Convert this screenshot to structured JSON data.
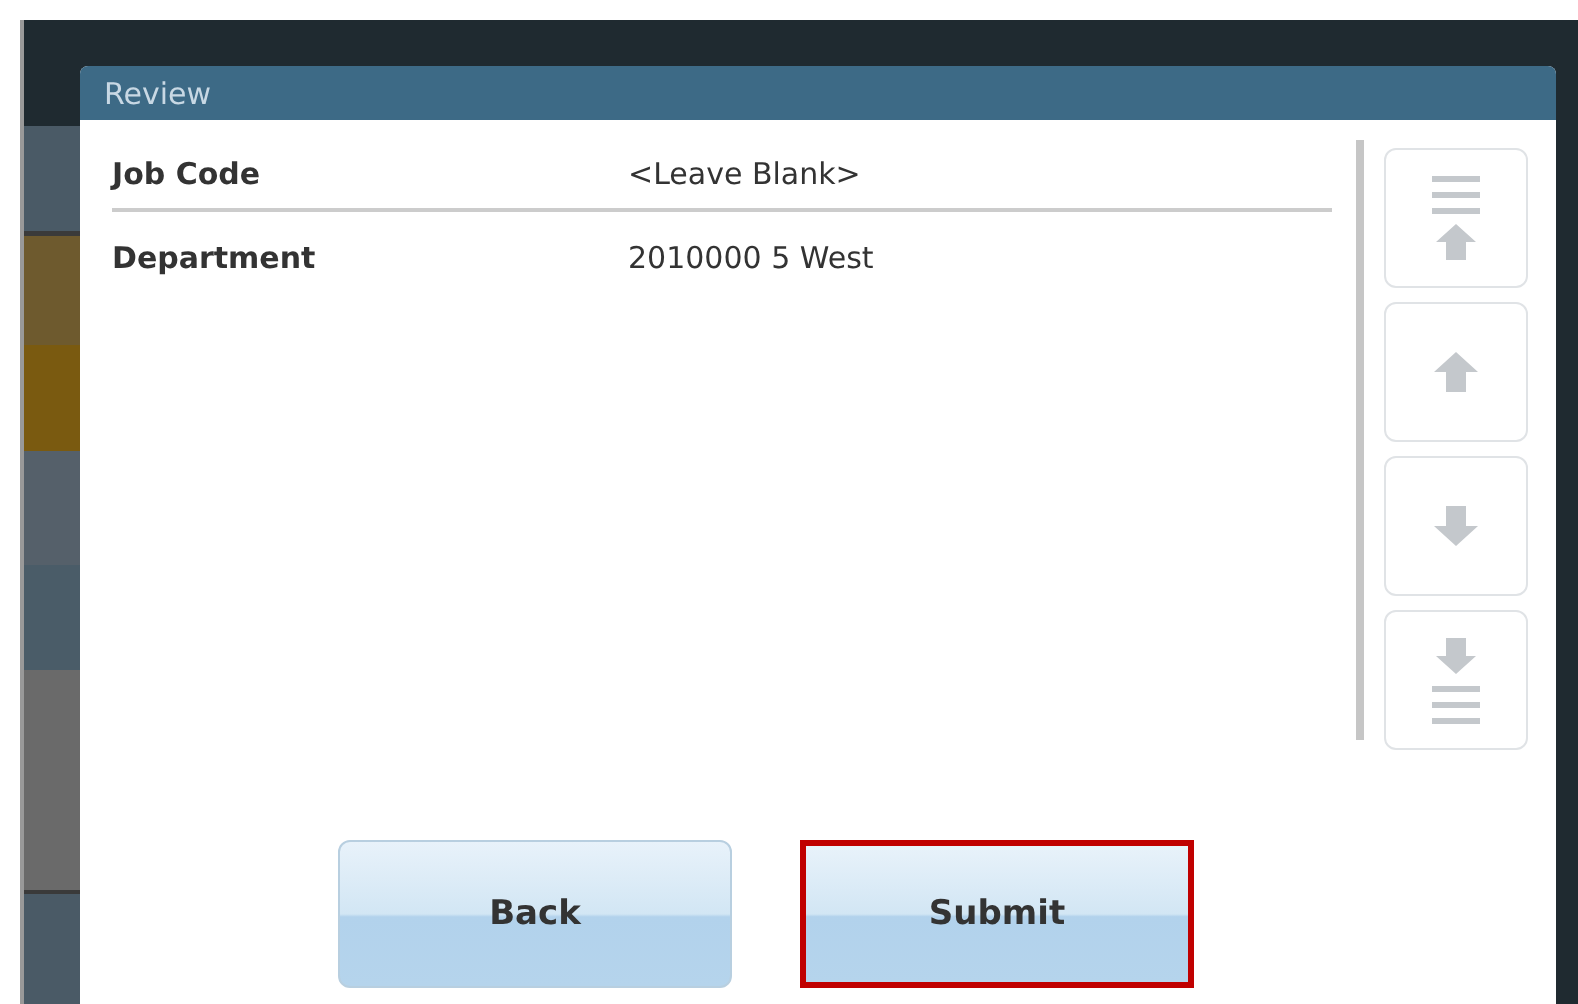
{
  "dialog": {
    "title": "Review",
    "fields": [
      {
        "label": "Job Code",
        "value": "<Leave Blank>"
      },
      {
        "label": "Department",
        "value": "2010000 5 West"
      }
    ],
    "scroll_buttons": [
      {
        "kind": "page-up"
      },
      {
        "kind": "up"
      },
      {
        "kind": "down"
      },
      {
        "kind": "page-down"
      }
    ],
    "buttons": [
      {
        "label": "Back",
        "highlighted": false
      },
      {
        "label": "Submit",
        "highlighted": true
      }
    ]
  }
}
